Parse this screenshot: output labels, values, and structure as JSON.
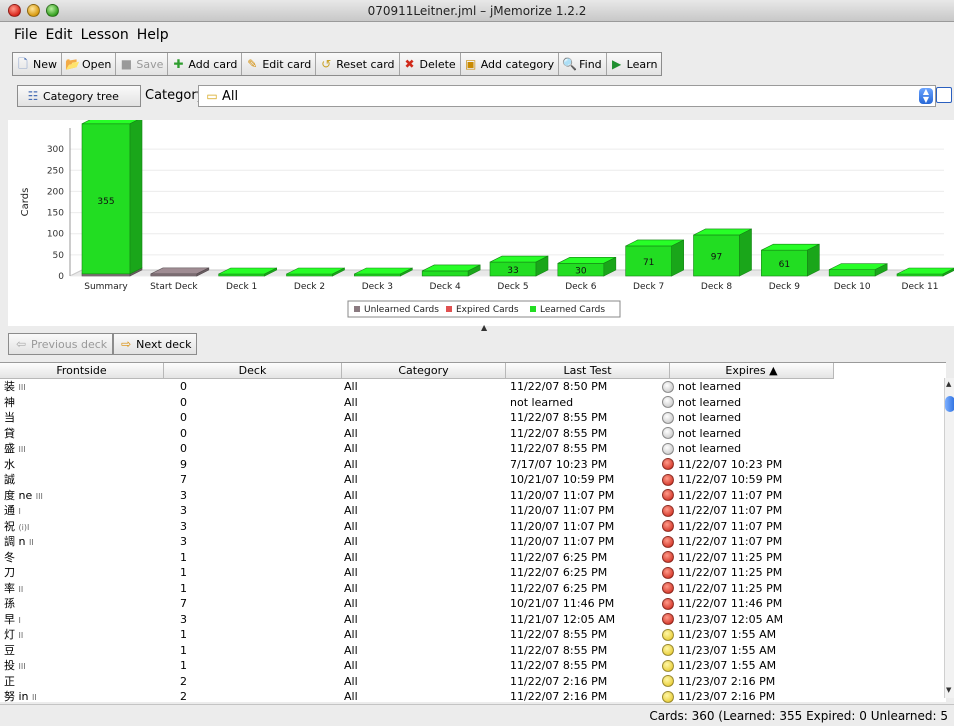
{
  "window": {
    "title": "070911Leitner.jml – jMemorize 1.2.2"
  },
  "menu": [
    "File",
    "Edit",
    "Lesson",
    "Help"
  ],
  "toolbar": [
    {
      "label": "New",
      "icon": "new-file-icon",
      "glyph": "🗋",
      "color": "#4a6fb5",
      "enabled": true
    },
    {
      "label": "Open",
      "icon": "open-folder-icon",
      "glyph": "📂",
      "color": "#c9a227",
      "enabled": true
    },
    {
      "label": "Save",
      "icon": "save-icon",
      "glyph": "■",
      "color": "#9a9a9a",
      "enabled": false
    },
    {
      "label": "Add card",
      "icon": "add-card-icon",
      "glyph": "✚",
      "color": "#2f9e2f",
      "enabled": true
    },
    {
      "label": "Edit card",
      "icon": "pencil-icon",
      "glyph": "✎",
      "color": "#d18a00",
      "enabled": true
    },
    {
      "label": "Reset card",
      "icon": "reset-icon",
      "glyph": "↺",
      "color": "#c9a227",
      "enabled": true
    },
    {
      "label": "Delete",
      "icon": "delete-icon",
      "glyph": "✖",
      "color": "#d02a1a",
      "enabled": true
    },
    {
      "label": "Add category",
      "icon": "add-category-icon",
      "glyph": "▣",
      "color": "#c98a00",
      "enabled": true
    },
    {
      "label": "Find",
      "icon": "search-icon",
      "glyph": "🔍",
      "color": "#555555",
      "enabled": true
    },
    {
      "label": "Learn",
      "icon": "learn-play-icon",
      "glyph": "▶",
      "color": "#1f8f2f",
      "enabled": true
    }
  ],
  "category_bar": {
    "tree_button": "Category tree",
    "label": "Category",
    "selected": "All"
  },
  "chart_data": {
    "type": "bar",
    "categories": [
      "Summary",
      "Start Deck",
      "Deck 1",
      "Deck 2",
      "Deck 3",
      "Deck 4",
      "Deck 5",
      "Deck 6",
      "Deck 7",
      "Deck 8",
      "Deck 9",
      "Deck 10",
      "Deck 11"
    ],
    "series": [
      {
        "name": "Unlearned Cards",
        "color": "#8a7a80",
        "values": [
          5,
          5,
          0,
          0,
          0,
          0,
          0,
          0,
          0,
          0,
          0,
          0,
          0
        ]
      },
      {
        "name": "Expired Cards",
        "color": "#e05050",
        "values": [
          0,
          0,
          0,
          0,
          0,
          0,
          0,
          0,
          0,
          0,
          0,
          0,
          0
        ]
      },
      {
        "name": "Learned Cards",
        "color": "#22dd22",
        "values": [
          355,
          0,
          1,
          2,
          4,
          12,
          33,
          30,
          71,
          97,
          61,
          15,
          2
        ]
      }
    ],
    "data_labels": [
      "355",
      "",
      "",
      "",
      "",
      "",
      "33",
      "30",
      "71",
      "97",
      "61",
      "",
      ""
    ],
    "ylabel": "Cards",
    "yticks": [
      "0",
      "50",
      "100",
      "150",
      "200",
      "250",
      "300"
    ],
    "ylim": [
      0,
      350
    ],
    "grid": true,
    "legend": "bottom-center"
  },
  "deck_nav": {
    "previous": "Previous deck",
    "next": "Next deck"
  },
  "table": {
    "columns": [
      "Frontside",
      "Deck",
      "Category",
      "Last Test",
      "Expires ▲"
    ],
    "rows": [
      {
        "front": "装",
        "sub": "III",
        "deck": "0",
        "category": "All",
        "last_test": "11/22/07 8:50 PM",
        "status": "gray",
        "expires": "not learned"
      },
      {
        "front": "神",
        "sub": "",
        "deck": "0",
        "category": "All",
        "last_test": "not learned",
        "status": "gray",
        "expires": "not learned"
      },
      {
        "front": "当",
        "sub": "",
        "deck": "0",
        "category": "All",
        "last_test": "11/22/07 8:55 PM",
        "status": "gray",
        "expires": "not learned"
      },
      {
        "front": "貸",
        "sub": "",
        "deck": "0",
        "category": "All",
        "last_test": "11/22/07 8:55 PM",
        "status": "gray",
        "expires": "not learned"
      },
      {
        "front": "盛",
        "sub": "III",
        "deck": "0",
        "category": "All",
        "last_test": "11/22/07 8:55 PM",
        "status": "gray",
        "expires": "not learned"
      },
      {
        "front": "水",
        "sub": "",
        "deck": "9",
        "category": "All",
        "last_test": "7/17/07 10:23 PM",
        "status": "red",
        "expires": "11/22/07 10:23 PM"
      },
      {
        "front": "誠",
        "sub": "",
        "deck": "7",
        "category": "All",
        "last_test": "10/21/07 10:59 PM",
        "status": "red",
        "expires": "11/22/07 10:59 PM"
      },
      {
        "front": "度 ne",
        "sub": "III",
        "deck": "3",
        "category": "All",
        "last_test": "11/20/07 11:07 PM",
        "status": "red",
        "expires": "11/22/07 11:07 PM"
      },
      {
        "front": "通",
        "sub": "I",
        "deck": "3",
        "category": "All",
        "last_test": "11/20/07 11:07 PM",
        "status": "red",
        "expires": "11/22/07 11:07 PM"
      },
      {
        "front": "祝",
        "sub": "(i)I",
        "deck": "3",
        "category": "All",
        "last_test": "11/20/07 11:07 PM",
        "status": "red",
        "expires": "11/22/07 11:07 PM"
      },
      {
        "front": "調 n",
        "sub": "II",
        "deck": "3",
        "category": "All",
        "last_test": "11/20/07 11:07 PM",
        "status": "red",
        "expires": "11/22/07 11:07 PM"
      },
      {
        "front": "冬",
        "sub": "",
        "deck": "1",
        "category": "All",
        "last_test": "11/22/07 6:25 PM",
        "status": "red",
        "expires": "11/22/07 11:25 PM"
      },
      {
        "front": "刀",
        "sub": "",
        "deck": "1",
        "category": "All",
        "last_test": "11/22/07 6:25 PM",
        "status": "red",
        "expires": "11/22/07 11:25 PM"
      },
      {
        "front": "率",
        "sub": "II",
        "deck": "1",
        "category": "All",
        "last_test": "11/22/07 6:25 PM",
        "status": "red",
        "expires": "11/22/07 11:25 PM"
      },
      {
        "front": "孫",
        "sub": "",
        "deck": "7",
        "category": "All",
        "last_test": "10/21/07 11:46 PM",
        "status": "red",
        "expires": "11/22/07 11:46 PM"
      },
      {
        "front": "早",
        "sub": "I",
        "deck": "3",
        "category": "All",
        "last_test": "11/21/07 12:05 AM",
        "status": "red",
        "expires": "11/23/07 12:05 AM"
      },
      {
        "front": "灯",
        "sub": "II",
        "deck": "1",
        "category": "All",
        "last_test": "11/22/07 8:55 PM",
        "status": "yellow",
        "expires": "11/23/07 1:55 AM"
      },
      {
        "front": "豆",
        "sub": "",
        "deck": "1",
        "category": "All",
        "last_test": "11/22/07 8:55 PM",
        "status": "yellow",
        "expires": "11/23/07 1:55 AM"
      },
      {
        "front": "投",
        "sub": "III",
        "deck": "1",
        "category": "All",
        "last_test": "11/22/07 8:55 PM",
        "status": "yellow",
        "expires": "11/23/07 1:55 AM"
      },
      {
        "front": "正",
        "sub": "",
        "deck": "2",
        "category": "All",
        "last_test": "11/22/07 2:16 PM",
        "status": "yellow",
        "expires": "11/23/07 2:16 PM"
      },
      {
        "front": "努 in",
        "sub": "II",
        "deck": "2",
        "category": "All",
        "last_test": "11/22/07 2:16 PM",
        "status": "yellow",
        "expires": "11/23/07 2:16 PM"
      }
    ]
  },
  "status": {
    "text": "Cards: 360 (Learned: 355  Expired: 0  Unlearned: 5"
  }
}
